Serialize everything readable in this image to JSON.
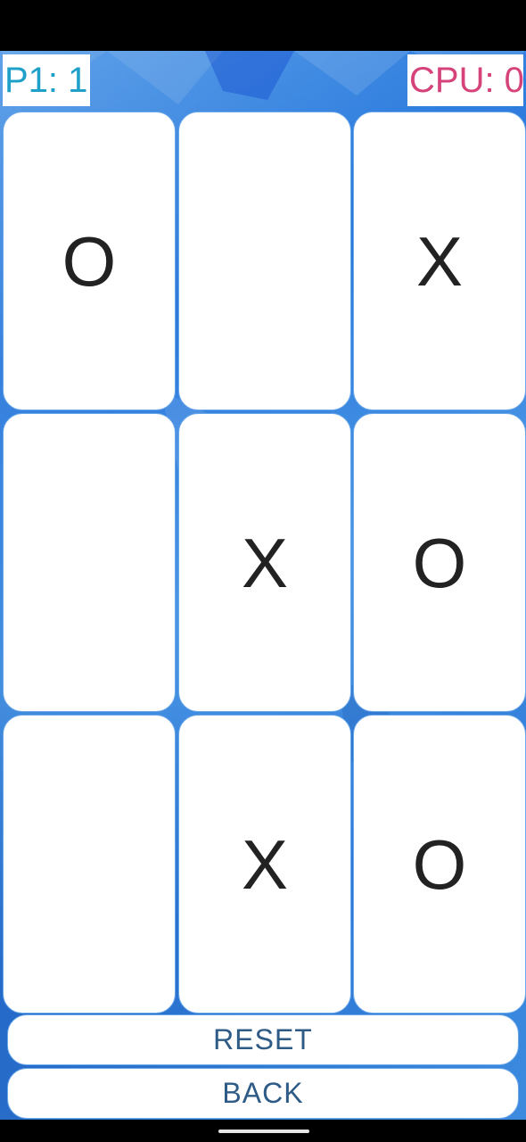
{
  "scores": {
    "player": "P1: 1",
    "cpu": "CPU: 0"
  },
  "board": {
    "cells": [
      "O",
      "",
      "X",
      "",
      "X",
      "O",
      "",
      "X",
      "O"
    ]
  },
  "buttons": {
    "reset": "RESET",
    "back": "BACK"
  },
  "colors": {
    "background": "#2e7ad8",
    "player_score": "#1fa0c9",
    "cpu_score": "#d6437a",
    "button_text": "#2e5a86",
    "mark": "#222222"
  }
}
